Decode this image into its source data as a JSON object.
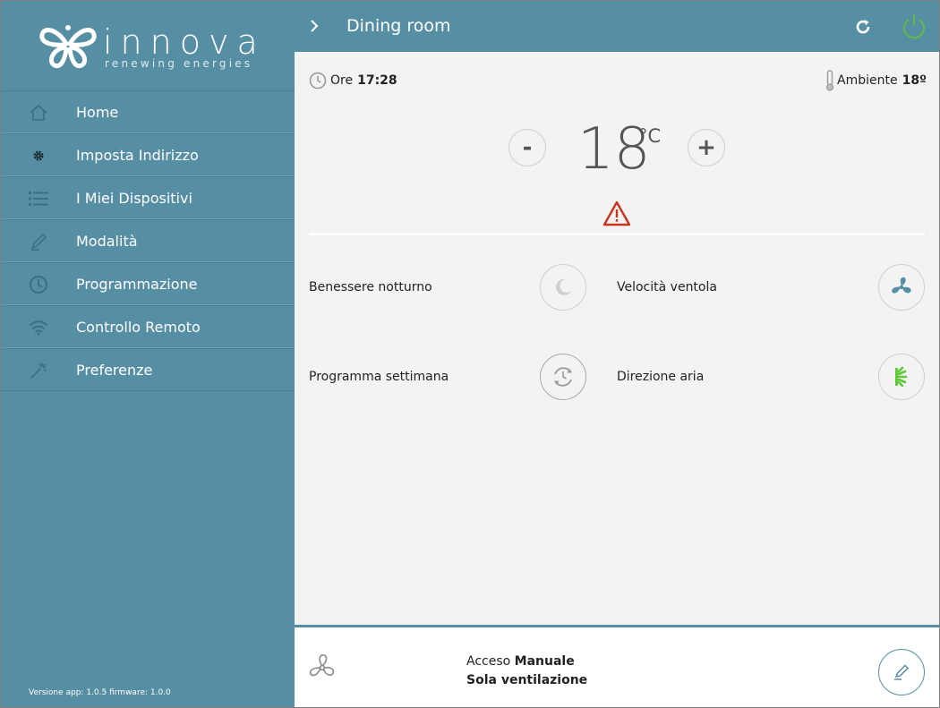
{
  "sidebar": {
    "brand": "innova",
    "tagline": "renewing energies",
    "items": [
      {
        "label": "Home",
        "icon": "home-icon"
      },
      {
        "label": "Imposta Indirizzo",
        "icon": "gear-icon"
      },
      {
        "label": "I Miei Dispositivi",
        "icon": "list-icon"
      },
      {
        "label": "Modalità",
        "icon": "pencil-icon"
      },
      {
        "label": "Programmazione",
        "icon": "clock-icon"
      },
      {
        "label": "Controllo Remoto",
        "icon": "wifi-icon"
      },
      {
        "label": "Preferenze",
        "icon": "magic-wand-icon"
      }
    ],
    "version": "Versione app: 1.0.5 firmware: 1.0.0"
  },
  "header": {
    "title": "Dining room"
  },
  "main": {
    "time_label": "Ore",
    "time_value": "17:28",
    "ambient_label": "Ambiente",
    "ambient_value": "18º",
    "setpoint_value": "18",
    "setpoint_unit": "°C",
    "minus_label": "-",
    "plus_label": "+",
    "options": {
      "night": "Benessere notturno",
      "fan": "Velocità ventola",
      "week": "Programma settimana",
      "air": "Direzione aria"
    }
  },
  "footer": {
    "status_prefix": "Acceso",
    "status_mode": "Manuale",
    "status_sub": "Sola ventilazione"
  },
  "colors": {
    "primary": "#568ea4",
    "power_on": "#5dbb46",
    "warning": "#c8341b",
    "air_direction": "#5fc93a"
  }
}
